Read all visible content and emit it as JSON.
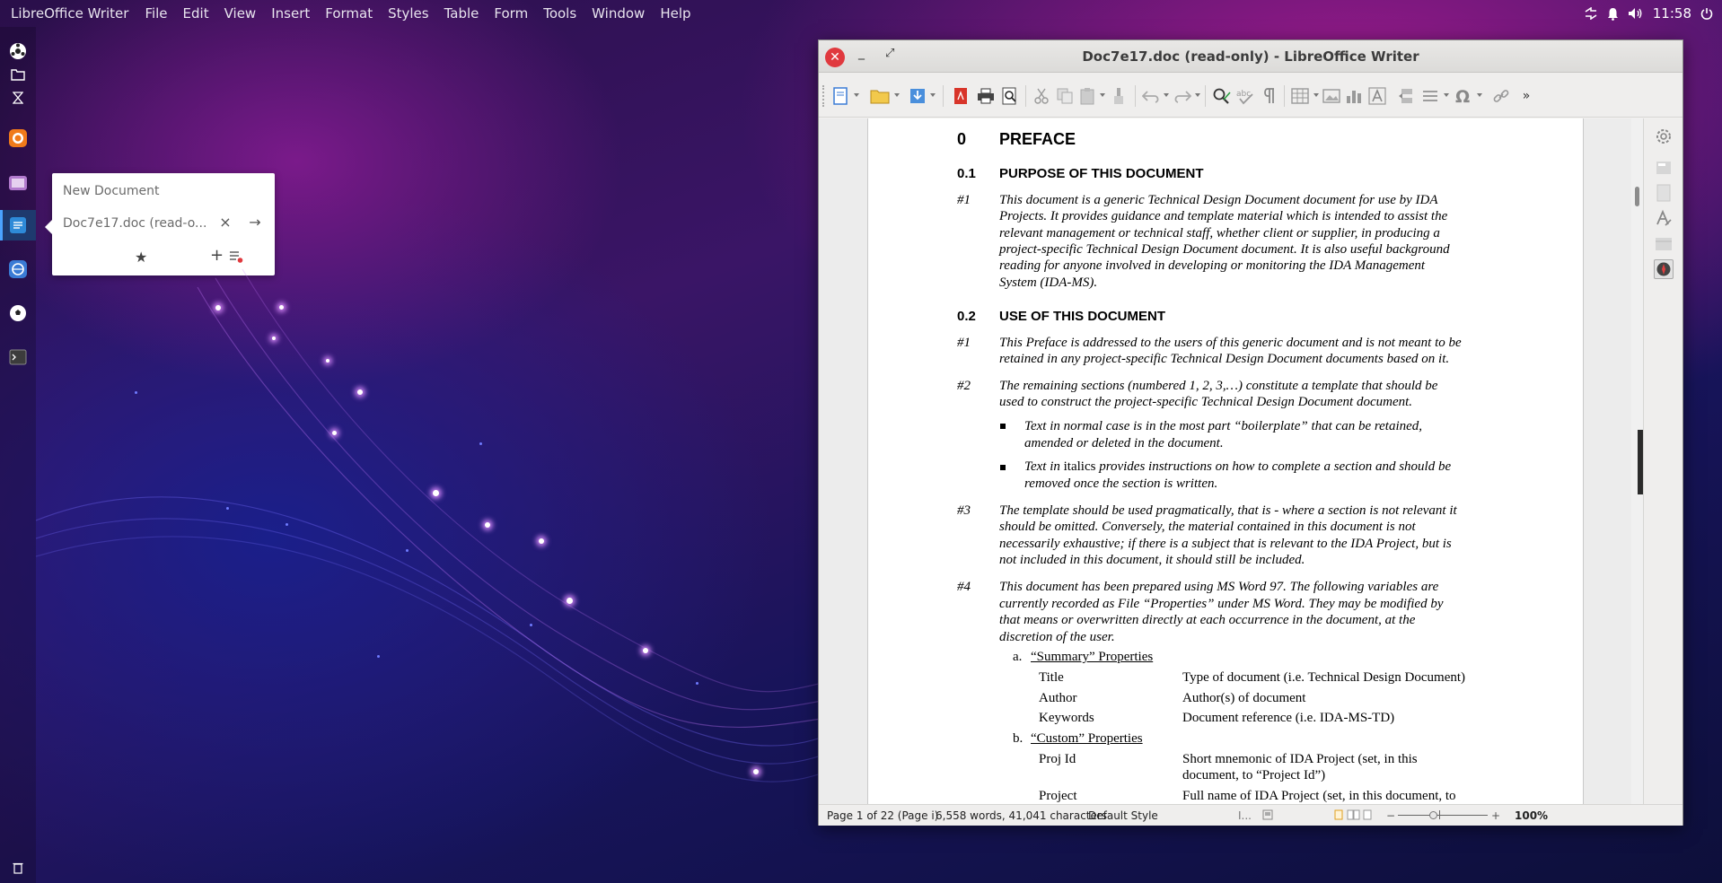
{
  "topbar": {
    "app_name": "LibreOffice Writer",
    "menu": [
      "File",
      "Edit",
      "View",
      "Insert",
      "Format",
      "Styles",
      "Table",
      "Form",
      "Tools",
      "Window",
      "Help"
    ],
    "clock": "11:58"
  },
  "dock_popup": {
    "new_document": "New Document",
    "open_document": "Doc7e17.doc (read-o...",
    "close_symbol": "×",
    "go_symbol": "→",
    "star_symbol": "★",
    "add_symbol": "+"
  },
  "window": {
    "title": "Doc7e17.doc (read-only) - LibreOffice Writer",
    "overflow_symbol": "»"
  },
  "document": {
    "h0": {
      "num": "0",
      "text": "PREFACE"
    },
    "h01": {
      "num": "0.1",
      "text": "PURPOSE OF THIS DOCUMENT"
    },
    "p01_1": {
      "num": "#1",
      "lines": [
        "This document is a generic Technical Design Document document for use by IDA",
        "Projects. It provides guidance and template material which is intended to assist the",
        "relevant management or technical staff, whether client or supplier, in producing a",
        "project-specific Technical Design Document document. It is also useful background",
        "reading for anyone involved in developing or monitoring the IDA Management",
        "System (IDA-MS)."
      ]
    },
    "h02": {
      "num": "0.2",
      "text": "USE OF THIS DOCUMENT"
    },
    "p02_1": {
      "num": "#1",
      "lines": [
        "This Preface is addressed to the users of this generic document and is not meant to be",
        "retained in any project-specific Technical Design Document documents based on it."
      ]
    },
    "p02_2": {
      "num": "#2",
      "lines": [
        "The remaining sections (numbered 1, 2, 3,…) constitute a template that should be",
        "used to construct the project-specific Technical Design Document document."
      ]
    },
    "bullet1": {
      "lines": [
        "Text in normal case is in the most part “boilerplate” that can be retained,",
        "amended or deleted in the document."
      ]
    },
    "bullet2": {
      "prefix": "Text in ",
      "normal_word": "italics",
      "lines": [
        " provides instructions on how to complete a section and should be",
        "removed once the section is written."
      ]
    },
    "p02_3": {
      "num": "#3",
      "lines": [
        "The template should be used pragmatically, that is - where a section is not relevant it",
        "should be omitted. Conversely, the material contained in this document is not",
        "necessarily exhaustive; if there is a subject that is relevant to the IDA Project, but is",
        "not included in this document, it should still be included."
      ]
    },
    "p02_4": {
      "num": "#4",
      "lines": [
        "This document has been prepared using MS Word 97.  The following variables are",
        "currently recorded as File “Properties” under MS Word.  They may be modified by",
        "that means or overwritten directly at each occurrence in the document, at the",
        "discretion of the user."
      ]
    },
    "list_a": {
      "marker": "a.",
      "label": "“Summary” Properties"
    },
    "summary_props": [
      {
        "name": "Title",
        "value": "Type of document (i.e. Technical Design Document)"
      },
      {
        "name": "Author",
        "value": "Author(s) of document"
      },
      {
        "name": "Keywords",
        "value": "Document reference (i.e. IDA-MS-TD)"
      }
    ],
    "list_b": {
      "marker": "b.",
      "label": "“Custom” Properties"
    },
    "custom_props": [
      {
        "name": "Proj Id",
        "value1": "Short mnemonic of IDA Project (set, in this",
        "value2": "document, to “Project Id”)"
      },
      {
        "name": "Project",
        "value1": "Full name of IDA Project (set, in this document, to",
        "value2": ""
      }
    ]
  },
  "statusbar": {
    "page": "Page 1 of 22 (Page i)",
    "words": "6,558 words, 41,041 characters",
    "style": "Default Style",
    "zoom": "100%"
  }
}
